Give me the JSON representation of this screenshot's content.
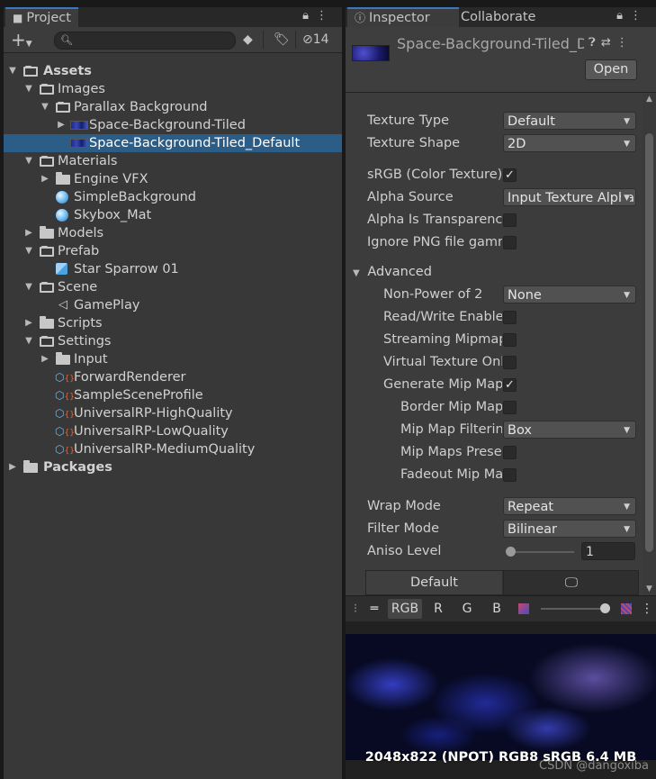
{
  "project": {
    "tab_label": "Project",
    "toolbar": {
      "add_label": "+",
      "hidden_count": "14"
    },
    "tree": [
      {
        "label": "Assets",
        "icon": "folder-open-icon",
        "expanded": true
      },
      {
        "label": "Images",
        "icon": "folder-open-icon",
        "expanded": true
      },
      {
        "label": "Parallax Background",
        "icon": "folder-open-icon",
        "expanded": true
      },
      {
        "label": "Space-Background-Tiled",
        "icon": "texture-icon",
        "expanded": false
      },
      {
        "label": "Space-Background-Tiled_Default",
        "icon": "texture-icon",
        "selected": true
      },
      {
        "label": "Materials",
        "icon": "folder-open-icon",
        "expanded": true
      },
      {
        "label": "Engine VFX",
        "icon": "folder-icon",
        "expanded": false
      },
      {
        "label": "SimpleBackground",
        "icon": "material-icon"
      },
      {
        "label": "Skybox_Mat",
        "icon": "material-icon"
      },
      {
        "label": "Models",
        "icon": "folder-icon",
        "expanded": false
      },
      {
        "label": "Prefab",
        "icon": "folder-open-icon",
        "expanded": true
      },
      {
        "label": "Star Sparrow 01",
        "icon": "prefab-icon"
      },
      {
        "label": "Scene",
        "icon": "folder-open-icon",
        "expanded": true
      },
      {
        "label": "GamePlay",
        "icon": "scene-icon"
      },
      {
        "label": "Scripts",
        "icon": "folder-icon",
        "expanded": false
      },
      {
        "label": "Settings",
        "icon": "folder-open-icon",
        "expanded": true
      },
      {
        "label": "Input",
        "icon": "folder-icon",
        "expanded": false
      },
      {
        "label": "ForwardRenderer",
        "icon": "scriptable-asset-icon"
      },
      {
        "label": "SampleSceneProfile",
        "icon": "scriptable-asset-icon"
      },
      {
        "label": "UniversalRP-HighQuality",
        "icon": "scriptable-asset-icon"
      },
      {
        "label": "UniversalRP-LowQuality",
        "icon": "scriptable-asset-icon"
      },
      {
        "label": "UniversalRP-MediumQuality",
        "icon": "scriptable-asset-icon"
      },
      {
        "label": "Packages",
        "icon": "folder-icon",
        "expanded": false
      }
    ]
  },
  "inspector": {
    "tab_label": "Inspector",
    "tab2_label": "Collaborate",
    "asset_title": "Space-Background-Tiled_Default",
    "open_label": "Open",
    "props": {
      "texture_type": {
        "label": "Texture Type",
        "value": "Default"
      },
      "texture_shape": {
        "label": "Texture Shape",
        "value": "2D"
      },
      "srgb": {
        "label": "sRGB (Color Texture)",
        "checked": true
      },
      "alpha_source": {
        "label": "Alpha Source",
        "value": "Input Texture Alpha"
      },
      "alpha_transparency": {
        "label": "Alpha Is Transparency",
        "checked": false
      },
      "ignore_png": {
        "label": "Ignore PNG file gamma",
        "checked": false
      },
      "advanced": {
        "label": "Advanced"
      },
      "npot": {
        "label": "Non-Power of 2",
        "value": "None"
      },
      "read_write": {
        "label": "Read/Write Enabled",
        "checked": false
      },
      "streaming": {
        "label": "Streaming Mipmaps",
        "checked": false
      },
      "virtual_tex": {
        "label": "Virtual Texture Only",
        "checked": false
      },
      "gen_mip": {
        "label": "Generate Mip Maps",
        "checked": true
      },
      "border_mip": {
        "label": "Border Mip Maps",
        "checked": false
      },
      "mip_filter": {
        "label": "Mip Map Filtering",
        "value": "Box"
      },
      "mip_preserve": {
        "label": "Mip Maps Preserve Coverage",
        "checked": false
      },
      "fadeout": {
        "label": "Fadeout Mip Maps",
        "checked": false
      },
      "wrap_mode": {
        "label": "Wrap Mode",
        "value": "Repeat"
      },
      "filter_mode": {
        "label": "Filter Mode",
        "value": "Bilinear"
      },
      "aniso": {
        "label": "Aniso Level",
        "value": "1",
        "slider_fraction": 0.0
      }
    },
    "platform_tabs": [
      "Default"
    ],
    "preview": {
      "channels": [
        "RGB",
        "R",
        "G",
        "B"
      ],
      "info": "2048x822 (NPOT)  RGB8 sRGB  6.4 MB",
      "watermark": "CSDN @dangoxiba"
    }
  }
}
